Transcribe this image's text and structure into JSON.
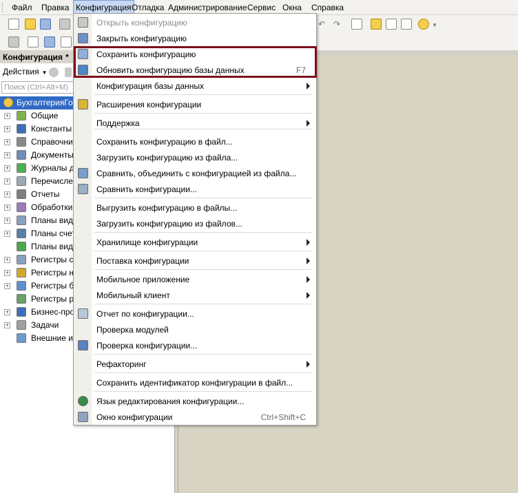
{
  "menubar": {
    "items": [
      "Файл",
      "Правка",
      "Конфигурация",
      "Отладка",
      "Администрирование",
      "Сервис",
      "Окна",
      "Справка"
    ],
    "active_index": 2
  },
  "left_panel": {
    "title": "Конфигурация",
    "modified_mark": "*",
    "actions_label": "Действия",
    "search_placeholder": "Поиск (Ctrl+Alt+M)",
    "tree": [
      {
        "label": "БухгалтерияГос",
        "icon": "config-root-icon",
        "expandable": false,
        "root": true
      },
      {
        "label": "Общие",
        "icon": "common-icon",
        "expandable": true
      },
      {
        "label": "Константы",
        "icon": "constants-icon",
        "expandable": true
      },
      {
        "label": "Справочник",
        "icon": "catalogs-icon",
        "expandable": true
      },
      {
        "label": "Документы",
        "icon": "documents-icon",
        "expandable": true
      },
      {
        "label": "Журналы до",
        "icon": "journals-icon",
        "expandable": true
      },
      {
        "label": "Перечислен",
        "icon": "enums-icon",
        "expandable": true
      },
      {
        "label": "Отчеты",
        "icon": "reports-icon",
        "expandable": true
      },
      {
        "label": "Обработки",
        "icon": "processing-icon",
        "expandable": true
      },
      {
        "label": "Планы видо",
        "icon": "chart-types-icon",
        "expandable": true
      },
      {
        "label": "Планы счето",
        "icon": "chart-accounts-icon",
        "expandable": true
      },
      {
        "label": "Планы видо",
        "icon": "calc-types-icon",
        "expandable": false
      },
      {
        "label": "Регистры св",
        "icon": "info-registers-icon",
        "expandable": true
      },
      {
        "label": "Регистры на",
        "icon": "accum-registers-icon",
        "expandable": true
      },
      {
        "label": "Регистры бу",
        "icon": "accounting-registers-icon",
        "expandable": true
      },
      {
        "label": "Регистры ра",
        "icon": "calc-registers-icon",
        "expandable": false
      },
      {
        "label": "Бизнес-проц",
        "icon": "business-process-icon",
        "expandable": true
      },
      {
        "label": "Задачи",
        "icon": "tasks-icon",
        "expandable": true
      },
      {
        "label": "Внешние ис",
        "icon": "external-sources-icon",
        "expandable": false
      }
    ]
  },
  "menu": {
    "items": [
      {
        "label": "Открыть конфигурацию",
        "disabled": true,
        "icon": "open-config-icon"
      },
      {
        "label": "Закрыть конфигурацию",
        "icon": "close-config-icon"
      },
      {
        "label": "Сохранить конфигурацию",
        "icon": "save-config-icon"
      },
      {
        "label": "Обновить конфигурацию базы данных",
        "shortcut": "F7",
        "icon": "update-db-icon"
      },
      {
        "label": "Конфигурация базы данных",
        "submenu": true
      },
      {
        "label": "Расширения конфигурации",
        "icon": "extensions-icon"
      },
      {
        "label": "Поддержка",
        "submenu": true
      },
      {
        "label": "Сохранить конфигурацию в файл..."
      },
      {
        "label": "Загрузить конфигурацию из файла..."
      },
      {
        "label": "Сравнить, объединить с конфигурацией из файла...",
        "icon": "compare-merge-icon"
      },
      {
        "label": "Сравнить конфигурации...",
        "icon": "compare-icon"
      },
      {
        "label": "Выгрузить конфигурацию в файлы..."
      },
      {
        "label": "Загрузить конфигурацию из файлов..."
      },
      {
        "label": "Хранилище конфигурации",
        "submenu": true
      },
      {
        "label": "Поставка конфигурации",
        "submenu": true
      },
      {
        "label": "Мобильное приложение",
        "submenu": true
      },
      {
        "label": "Мобильный клиент",
        "submenu": true
      },
      {
        "label": "Отчет по конфигурации...",
        "icon": "report-icon"
      },
      {
        "label": "Проверка модулей"
      },
      {
        "label": "Проверка конфигурации...",
        "icon": "check-config-icon"
      },
      {
        "label": "Рефакторинг",
        "submenu": true
      },
      {
        "label": "Сохранить идентификатор конфигурации в файл..."
      },
      {
        "label": "Язык редактирования конфигурации...",
        "icon": "language-icon"
      },
      {
        "label": "Окно конфигурации",
        "shortcut": "Ctrl+Shift+C",
        "icon": "config-window-icon"
      }
    ]
  },
  "colors": {
    "highlight_border": "#7a0f1c",
    "selection": "#316ac5",
    "menu_active": "#c7d9f2"
  }
}
